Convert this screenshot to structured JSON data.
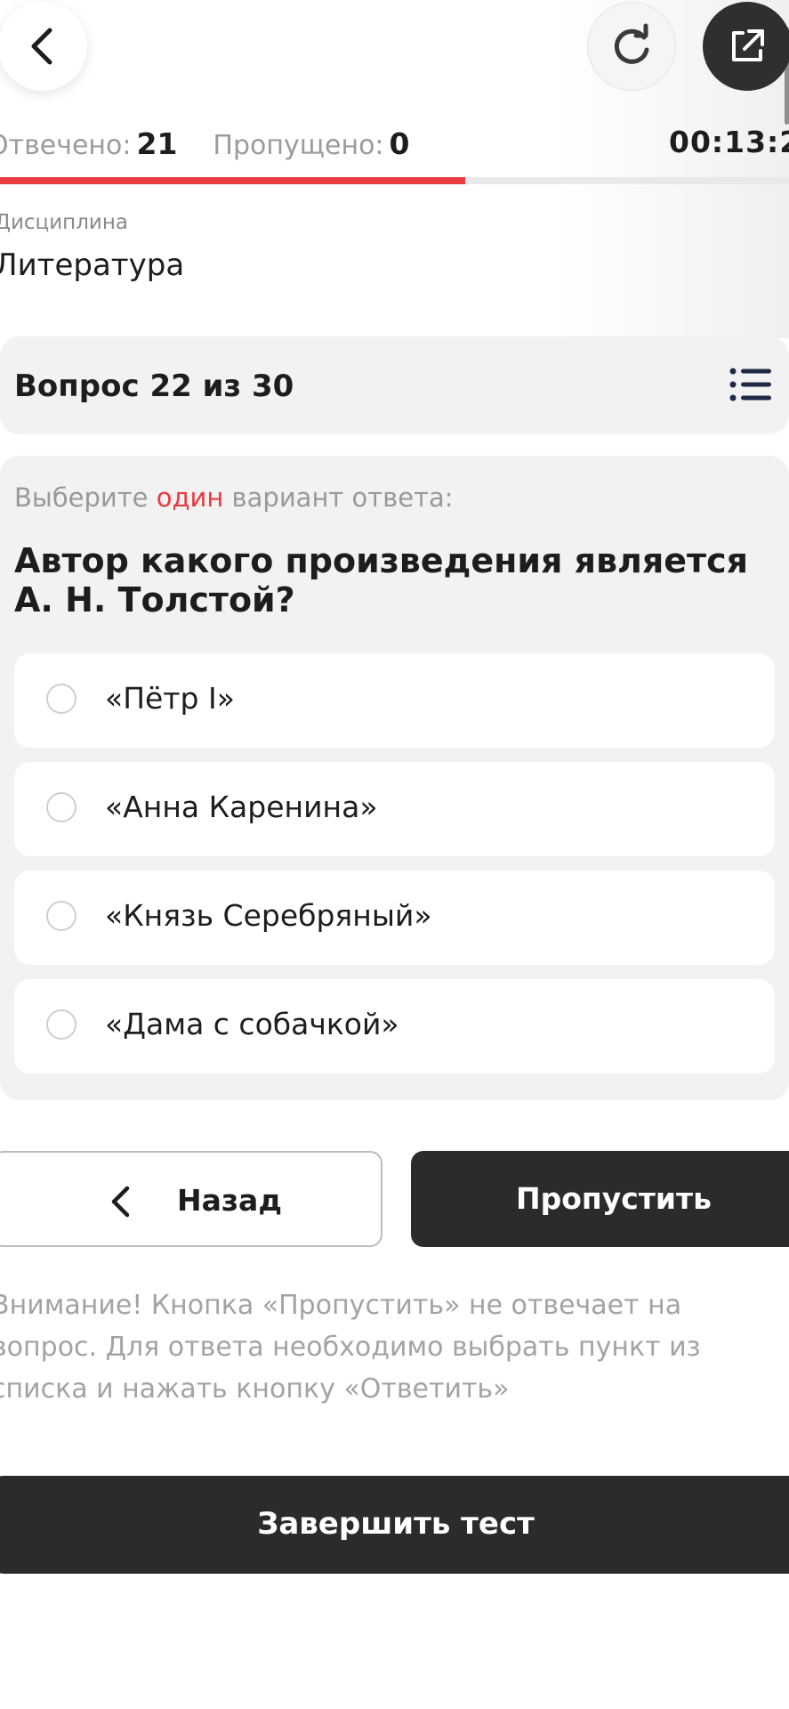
{
  "topbar": {
    "back_icon": "chevron-left-icon",
    "reload_icon": "reload-icon",
    "external_icon": "external-link-icon"
  },
  "stats": {
    "answered_label": "Отвечено:",
    "answered_value": "21",
    "skipped_label": "Пропущено:",
    "skipped_value": "0",
    "timer": "00:13:2",
    "progress_fraction": 0.59,
    "progress_color": "#e83b42"
  },
  "discipline": {
    "label": "Дисциплина",
    "value": "Литература"
  },
  "question": {
    "header_title": "Вопрос 22 из 30",
    "list_icon": "list-icon",
    "instruction_before": "Выберите ",
    "instruction_accent": "один",
    "instruction_after": " вариант ответа:",
    "text": "Автор какого произведения является А. Н. Толстой?",
    "options": [
      {
        "label": "«Пётр I»"
      },
      {
        "label": "«Анна Каренина»"
      },
      {
        "label": "«Князь Серебряный»"
      },
      {
        "label": "«Дама с собачкой»"
      }
    ]
  },
  "actions": {
    "back_label": "Назад",
    "skip_label": "Пропустить",
    "finish_label": "Завершить тест"
  },
  "notice": {
    "text": "Внимание! Кнопка «Пропустить» не отвечает на вопрос. Для ответа необходимо выбрать пункт из списка и нажать кнопку «Ответить»"
  }
}
